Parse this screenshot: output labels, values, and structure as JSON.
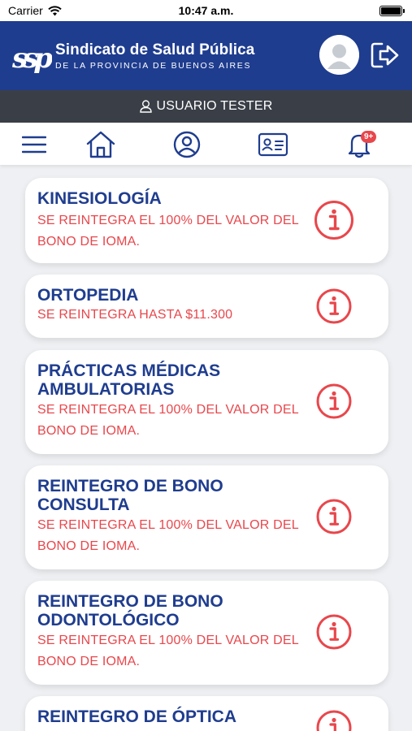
{
  "status_bar": {
    "carrier": "Carrier",
    "time": "10:47 a.m."
  },
  "header": {
    "brand_name": "Sindicato de Salud Pública",
    "brand_subtitle": "DE LA PROVINCIA DE BUENOS AIRES",
    "logo_text": "ssp"
  },
  "user_bar": {
    "username": "USUARIO TESTER"
  },
  "nav": {
    "notifications_badge": "9+"
  },
  "benefits": [
    {
      "title": "KINESIOLOGÍA",
      "description": "SE REINTEGRA EL 100% DEL VALOR DEL BONO DE IOMA."
    },
    {
      "title": "ORTOPEDIA",
      "description": "SE REINTEGRA HASTA $11.300"
    },
    {
      "title": "PRÁCTICAS MÉDICAS AMBULATORIAS",
      "description": "SE REINTEGRA EL 100% DEL VALOR DEL BONO DE IOMA."
    },
    {
      "title": "REINTEGRO DE BONO CONSULTA",
      "description": "SE REINTEGRA EL 100% DEL VALOR DEL BONO DE IOMA."
    },
    {
      "title": "REINTEGRO DE BONO ODONTOLÓGICO",
      "description": "SE REINTEGRA EL 100% DEL VALOR DEL BONO DE IOMA."
    },
    {
      "title": "REINTEGRO DE ÓPTICA",
      "description": ""
    }
  ],
  "colors": {
    "primary": "#1f3d8f",
    "accent": "#e8474c",
    "user_bar": "#3a3f47",
    "background": "#eef0f3"
  },
  "icons": {
    "status": [
      "wifi-icon",
      "battery-icon"
    ],
    "header": [
      "ssp-logo",
      "avatar-icon",
      "logout-icon"
    ],
    "user_bar": [
      "user-icon"
    ],
    "nav": [
      "menu-icon",
      "home-icon",
      "profile-icon",
      "id-card-icon",
      "bell-icon"
    ],
    "card": "info-icon"
  }
}
